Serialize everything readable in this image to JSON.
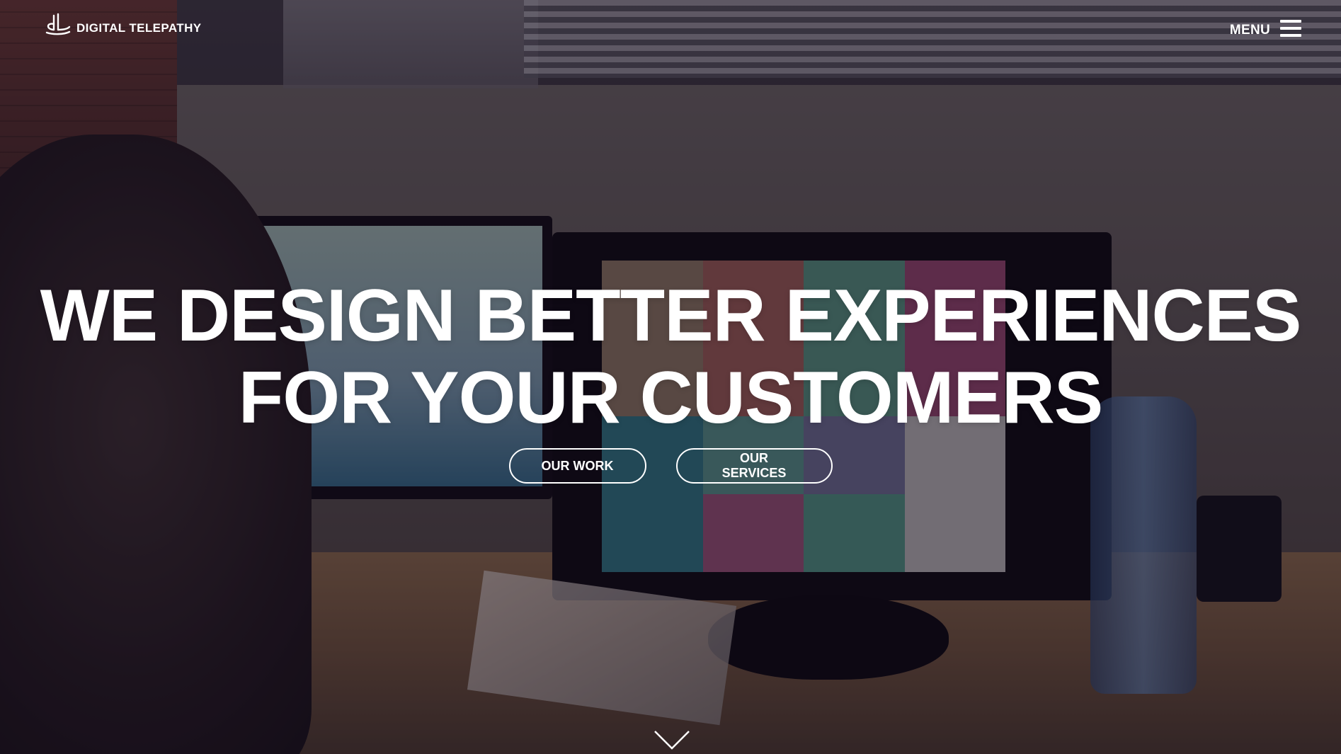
{
  "header": {
    "logo_text": "DIGITAL TELEPATHY",
    "logo_icon": "digital-telepathy-logo-icon",
    "menu_label": "MENU",
    "menu_icon": "hamburger-icon"
  },
  "hero": {
    "headline_line1": "WE DESIGN BETTER EXPERIENCES",
    "headline_line2": "FOR YOUR CUSTOMERS",
    "cta_primary": "OUR WORK",
    "cta_secondary": "OUR SERVICES",
    "scroll_icon": "chevron-down-icon",
    "background": "office-video-background"
  },
  "colors": {
    "text": "#ffffff",
    "overlay": "#120a1e"
  }
}
